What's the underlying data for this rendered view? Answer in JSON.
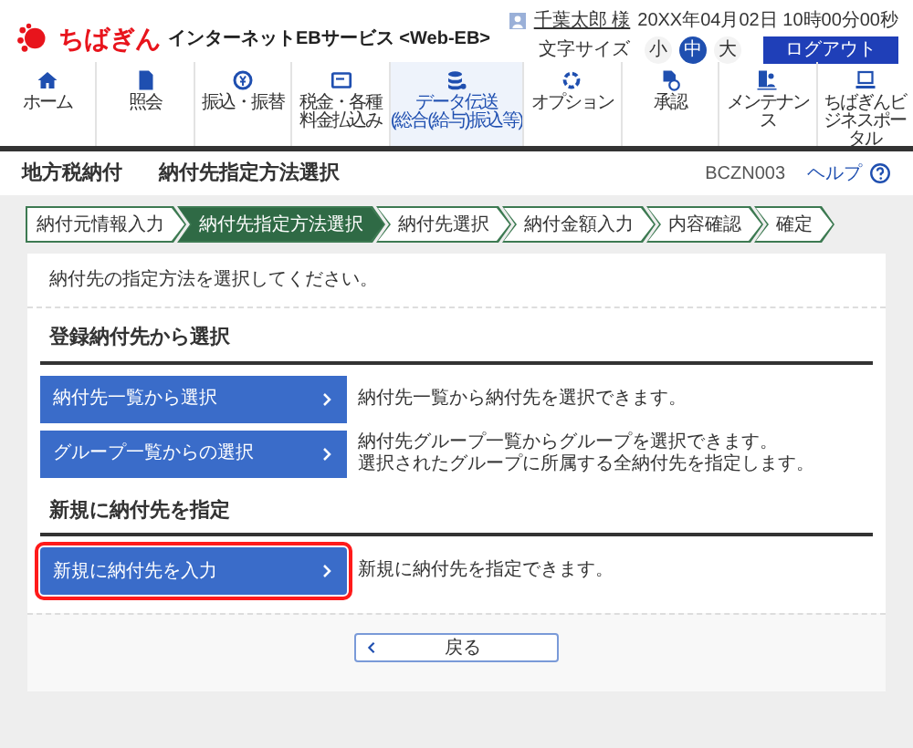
{
  "header": {
    "logo_text": "ちばぎん",
    "service_name": "インターネットEBサービス <Web-EB>",
    "user_name": "千葉太郎 様",
    "datetime": "20XX年04月02日 10時00分00秒",
    "font_size_label": "文字サイズ",
    "font_sizes": [
      {
        "label": "小",
        "selected": false
      },
      {
        "label": "中",
        "selected": true
      },
      {
        "label": "大",
        "selected": false
      }
    ],
    "logout": "ログアウト"
  },
  "nav": [
    {
      "label": "ホーム",
      "selected": false
    },
    {
      "label": "照会",
      "selected": false
    },
    {
      "label": "振込・振替",
      "selected": false
    },
    {
      "label": "税金・各種料金払込み",
      "selected": false
    },
    {
      "label": "データ伝送",
      "sub": "(総合(給与)振込等)",
      "selected": true
    },
    {
      "label": "オプション",
      "selected": false
    },
    {
      "label": "承認",
      "selected": false
    },
    {
      "label": "メンテナンス",
      "selected": false
    },
    {
      "label": "ちばぎんビジネスポータル",
      "selected": false
    }
  ],
  "page_title": {
    "category": "地方税納付",
    "title": "納付先指定方法選択",
    "screen_id": "BCZN003",
    "help": "ヘルプ"
  },
  "steps": [
    {
      "label": "納付元情報入力",
      "selected": false
    },
    {
      "label": "納付先指定方法選択",
      "selected": true
    },
    {
      "label": "納付先選択",
      "selected": false
    },
    {
      "label": "納付金額入力",
      "selected": false
    },
    {
      "label": "内容確認",
      "selected": false
    },
    {
      "label": "確定",
      "selected": false
    }
  ],
  "instruction": "納付先の指定方法を選択してください。",
  "sections": [
    {
      "heading": "登録納付先から選択",
      "options": [
        {
          "label": "納付先一覧から選択",
          "description": [
            "納付先一覧から納付先を選択できます。"
          ],
          "highlighted": false
        },
        {
          "label": "グループ一覧からの選択",
          "description": [
            "納付先グループ一覧からグループを選択できます。",
            "選択されたグループに所属する全納付先を指定します。"
          ],
          "highlighted": false
        }
      ]
    },
    {
      "heading": "新規に納付先を指定",
      "options": [
        {
          "label": "新規に納付先を入力",
          "description": [
            "新規に納付先を指定できます。"
          ],
          "highlighted": true
        }
      ]
    }
  ],
  "back_button": "戻る"
}
